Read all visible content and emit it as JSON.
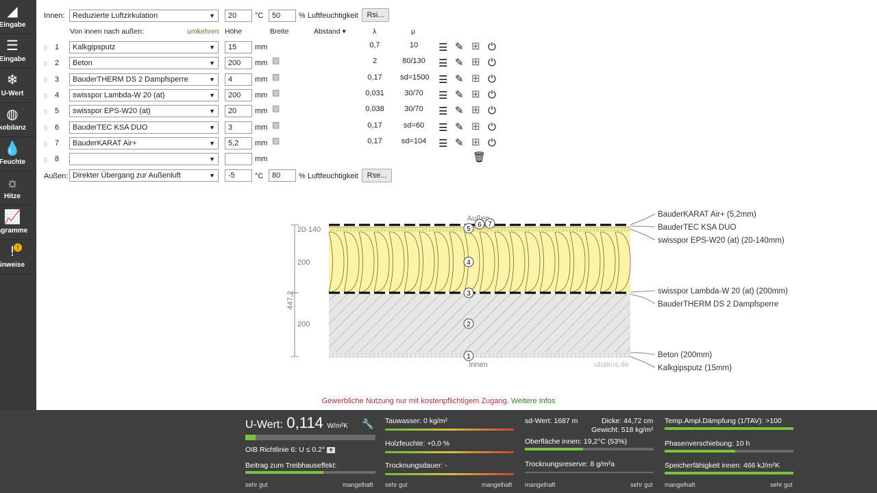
{
  "sidebar": {
    "items": [
      {
        "icon": "ruler-triangle-icon",
        "glyph": "◢",
        "label": "Eingabe"
      },
      {
        "icon": "edit-list-icon",
        "glyph": "☰",
        "label": "Eingabe"
      },
      {
        "icon": "snow-thermometer-icon",
        "glyph": "❄",
        "label": "U-Wert"
      },
      {
        "icon": "globe-icon",
        "glyph": "◍",
        "label": "kobilanz"
      },
      {
        "icon": "drop-icon",
        "glyph": "💧",
        "label": "Feuchte"
      },
      {
        "icon": "sun-icon",
        "glyph": "☼",
        "label": "Hitze"
      },
      {
        "icon": "chart-icon",
        "glyph": "📈",
        "label": "agramme"
      },
      {
        "icon": "warning-icon",
        "glyph": "!",
        "label": "inweise",
        "badge": "!"
      }
    ]
  },
  "inside": {
    "label": "Innen:",
    "climate": "Reduzierte Luftzirkulation",
    "temp": "20",
    "temp_unit": "°C",
    "humidity": "50",
    "humidity_label": "% Luftfeuchtigkeit",
    "button": "Rsi..."
  },
  "headers": {
    "direction": "Von innen nach außen:",
    "reverse": "umkehren",
    "height": "Höhe",
    "width": "Breite",
    "distance": "Abstand",
    "lambda": "λ",
    "mu": "μ"
  },
  "layers": [
    {
      "n": "1",
      "material": "Kalkgipsputz",
      "height": "15",
      "unit": "mm",
      "lambda": "0,7",
      "mu": "10",
      "hatch": false
    },
    {
      "n": "2",
      "material": "Beton",
      "height": "200",
      "unit": "mm",
      "lambda": "2",
      "mu": "80/130",
      "hatch": true
    },
    {
      "n": "3",
      "material": "BauderTHERM DS 2 Dampfsperre",
      "height": "4",
      "unit": "mm",
      "lambda": "0,17",
      "mu": "sd=1500",
      "hatch": true
    },
    {
      "n": "4",
      "material": "swisspor Lambda-W 20 (at)",
      "height": "200",
      "unit": "mm",
      "lambda": "0,031",
      "mu": "30/70",
      "hatch": true
    },
    {
      "n": "5",
      "material": "swisspor EPS-W20 (at)",
      "height": "20",
      "unit": "mm",
      "lambda": "0,038",
      "mu": "30/70",
      "hatch": true
    },
    {
      "n": "6",
      "material": "BauderTEC KSA DUO",
      "height": "3",
      "unit": "mm",
      "lambda": "0,17",
      "mu": "sd=60",
      "hatch": true
    },
    {
      "n": "7",
      "material": "BauderKARAT Air+",
      "height": "5,2",
      "unit": "mm",
      "lambda": "0,17",
      "mu": "sd=104",
      "hatch": true
    },
    {
      "n": "8",
      "material": "",
      "height": "",
      "unit": "mm",
      "lambda": "",
      "mu": "",
      "hatch": false
    }
  ],
  "outside": {
    "label": "Außen:",
    "climate": "Direkter Übergang zur Außenluft",
    "temp": "-5",
    "temp_unit": "°C",
    "humidity": "80",
    "humidity_label": "% Luftfeuchtigkeit",
    "button": "Rse..."
  },
  "drawing": {
    "top_label": "Außen",
    "bottom_label": "Innen",
    "watermark": "ubakus.de",
    "dim_total": "447,2",
    "dim_top": "20-140",
    "dim_insulation": "200",
    "dim_concrete": "200",
    "callouts": {
      "karat": "BauderKARAT Air+ (5,2mm)",
      "ksa": "BauderTEC KSA DUO",
      "eps": "swisspor EPS-W20 (at) (20-140mm)",
      "lambda": "swisspor Lambda-W 20 (at) (200mm)",
      "ds2": "BauderTHERM DS 2 Dampfsperre",
      "beton": "Beton (200mm)",
      "putz": "Kalkgipsputz (15mm)"
    }
  },
  "notice": {
    "text": "Gewerbliche Nutzung nur mit kostenpflichtigem Zugang.",
    "link": "Weitere Infos"
  },
  "results": {
    "uwert_label": "U-Wert:",
    "uwert_value": "0,114",
    "uwert_unit": "W/m²K",
    "oib": "OIB Richtlinie 6: U ≤ 0.2°",
    "greenhouse": "Beitrag zum Treibhauseffekt:",
    "scale_good": "sehr gut",
    "scale_bad": "mangelhaft",
    "tauwasser": "Tauwasser: 0 kg/m²",
    "holzfeuchte": "Holzfeuchte: +0,0 %",
    "trocknungsdauer": "Trocknungsdauer: -",
    "sd": "sd-Wert: 1687 m",
    "dicke": "Dicke: 44,72 cm",
    "gewicht": "Gewicht: 518 kg/m²",
    "oberflaeche": "Oberfläche innen: 19,2°C (53%)",
    "trocknungsreserve": "Trocknungsreserve: 8 g/m²a",
    "tav": "Temp.Ampl.Dämpfung (1/TAV): >100",
    "phase": "Phasenverschiebung: 10 h",
    "speicher": "Speicherfähigkeit innen: 466 kJ/m²K",
    "uwert_level": 0.08,
    "greenhouse_level": 0.6,
    "holzfeuchte_level": 0.0,
    "oberflaeche_level": 0.45,
    "tav_level": 1.0,
    "phase_level": 0.55,
    "speicher_level": 1.0
  }
}
